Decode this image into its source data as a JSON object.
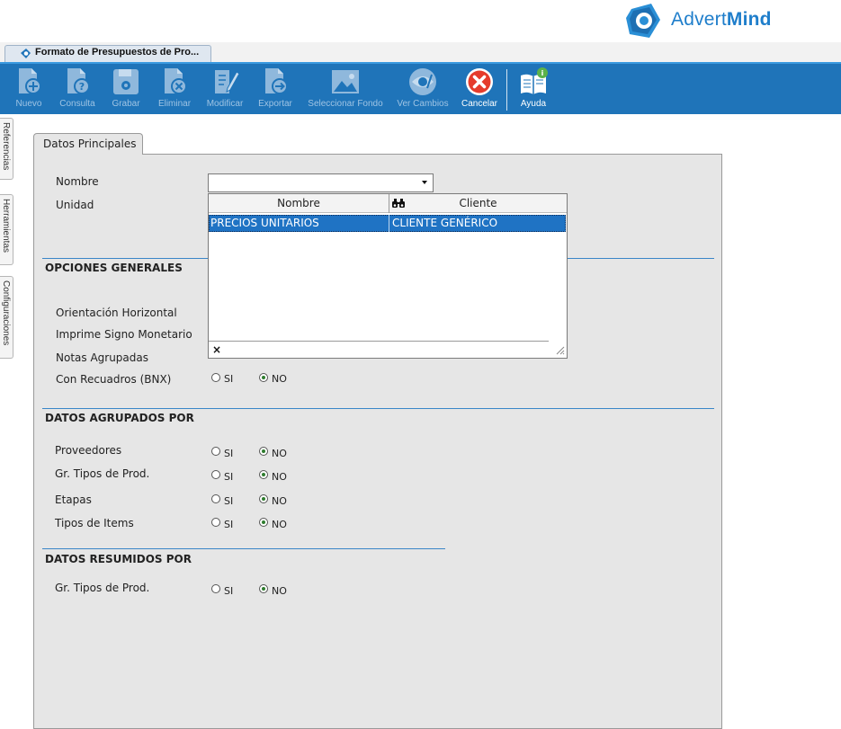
{
  "brand": {
    "name_light": "Advert",
    "name_bold": "Mind",
    "color": "#1f7ecb"
  },
  "window_tab": {
    "label": "Formato de Presupuestos de Pro..."
  },
  "toolbar": {
    "buttons": [
      {
        "label": "Nuevo",
        "icon": "new-document-icon",
        "enabled": false
      },
      {
        "label": "Consulta",
        "icon": "query-document-icon",
        "enabled": false
      },
      {
        "label": "Grabar",
        "icon": "save-disk-icon",
        "enabled": false
      },
      {
        "label": "Eliminar",
        "icon": "delete-document-icon",
        "enabled": false
      },
      {
        "label": "Modificar",
        "icon": "edit-document-icon",
        "enabled": false
      },
      {
        "label": "Exportar",
        "icon": "export-document-icon",
        "enabled": false
      },
      {
        "label": "Seleccionar Fondo",
        "icon": "image-icon",
        "enabled": false
      },
      {
        "label": "Ver Cambios",
        "icon": "view-changes-icon",
        "enabled": false
      },
      {
        "label": "Cancelar",
        "icon": "cancel-icon",
        "enabled": true
      },
      {
        "label": "Ayuda",
        "icon": "help-book-icon",
        "enabled": true
      }
    ]
  },
  "side_tabs": [
    "Referencias",
    "Herramientas",
    "Configuraciones"
  ],
  "panel_tab": {
    "label": "Datos Principales"
  },
  "fields": {
    "nombre_label": "Nombre",
    "unidad_label": "Unidad",
    "nombre_value": ""
  },
  "dropdown": {
    "columns": [
      "Nombre",
      "Cliente"
    ],
    "rows": [
      {
        "nombre": "PRECIOS UNITARIOS",
        "cliente": "CLIENTE GENÉRICO",
        "selected": true
      }
    ],
    "close_glyph": "×"
  },
  "radio_text": {
    "si": "SI",
    "no": "NO"
  },
  "sections": {
    "opciones_generales": {
      "title": "OPCIONES GENERALES",
      "items": [
        {
          "label": "Orientación Horizontal",
          "value": "NO"
        },
        {
          "label": "Imprime Signo Monetario",
          "value": "NO"
        },
        {
          "label": "Notas Agrupadas",
          "value": "NO"
        },
        {
          "label": "Con Recuadros (BNX)",
          "value": "NO"
        }
      ]
    },
    "datos_agrupados": {
      "title": "DATOS AGRUPADOS POR",
      "items": [
        {
          "label": "Proveedores",
          "value": "NO"
        },
        {
          "label": "Gr. Tipos de Prod.",
          "value": "NO"
        },
        {
          "label": "Etapas",
          "value": "NO"
        },
        {
          "label": "Tipos de Items",
          "value": "NO"
        }
      ]
    },
    "datos_resumidos": {
      "title": "DATOS RESUMIDOS POR",
      "items": [
        {
          "label": "Gr. Tipos de Prod.",
          "value": "NO"
        }
      ]
    }
  }
}
